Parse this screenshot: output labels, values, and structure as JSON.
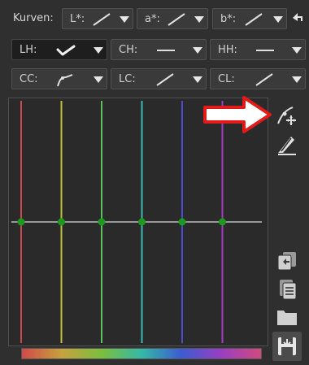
{
  "toolbar": {
    "kurven_label": "Kurven:",
    "row1": [
      {
        "label": "L*:",
        "curve": "linear"
      },
      {
        "label": "a*:",
        "curve": "linear"
      },
      {
        "label": "b*:",
        "curve": "linear"
      }
    ],
    "row2": [
      {
        "label": "LH:",
        "curve": "custom",
        "active": true
      },
      {
        "label": "CH:",
        "curve": "flat"
      },
      {
        "label": "HH:",
        "curve": "flat"
      }
    ],
    "row3": [
      {
        "label": "CC:",
        "curve": "custom"
      },
      {
        "label": "LC:",
        "curve": "linear"
      },
      {
        "label": "CL:",
        "curve": "linear"
      }
    ]
  },
  "graph": {
    "line_colors": [
      "#c94a4a",
      "#bfbf3c",
      "#5fbf5f",
      "#3cb9b3",
      "#4b4bd1",
      "#a33cc4"
    ],
    "node_color": "#1e9a1e",
    "midline": 0.5
  },
  "icons": {
    "undo": "undo-arrow-icon",
    "edit_node": "edit-node-icon",
    "edit_pen": "edit-pen-icon",
    "copy": "copy-icon",
    "paste": "paste-icon",
    "open": "folder-open-icon",
    "save": "save-icon"
  },
  "annotation_color": "#e21a1a"
}
